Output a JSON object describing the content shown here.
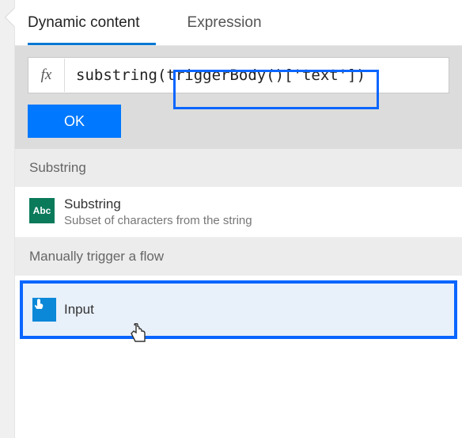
{
  "tabs": {
    "dynamic": "Dynamic content",
    "expression": "Expression"
  },
  "expression": {
    "fx": "fx",
    "value": "substring(triggerBody()['text'])"
  },
  "ok_label": "OK",
  "sections": {
    "substring_header": "Substring",
    "substring_item": {
      "title": "Substring",
      "sub": "Subset of characters from the string",
      "icon_label": "Abc"
    },
    "manual_header": "Manually trigger a flow",
    "input_item": {
      "title": "Input"
    }
  }
}
